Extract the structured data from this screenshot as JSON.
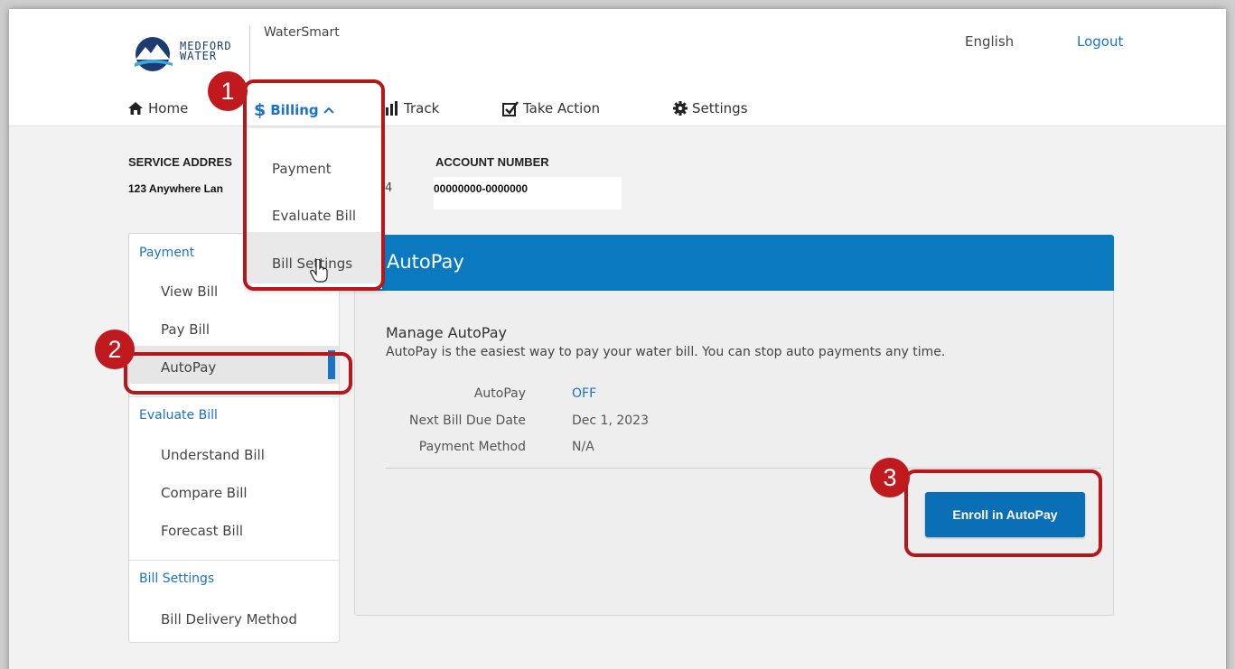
{
  "app": {
    "name": "WaterSmart",
    "logo_text": "MEDFORD WATER"
  },
  "header": {
    "language": "English",
    "logout": "Logout"
  },
  "nav": {
    "home": "Home",
    "billing": "Billing",
    "track": "Track",
    "take_action": "Take Action",
    "settings": "Settings"
  },
  "billing_menu": {
    "items": [
      "Payment",
      "Evaluate Bill",
      "Bill Settings"
    ]
  },
  "account": {
    "service_address_label": "SERVICE ADDRES",
    "service_address_value": "123 Anywhere Lan",
    "service_address_tail": "4",
    "account_number_label": "ACCOUNT NUMBER",
    "account_number_value": "00000000-0000000"
  },
  "sidebar": {
    "payment_header": "Payment",
    "payment_items": [
      "View Bill",
      "Pay Bill",
      "AutoPay"
    ],
    "evaluate_header": "Evaluate Bill",
    "evaluate_items": [
      "Understand Bill",
      "Compare Bill",
      "Forecast Bill"
    ],
    "settings_header": "Bill Settings",
    "settings_items": [
      "Bill Delivery Method"
    ],
    "active": "AutoPay"
  },
  "panel": {
    "title": "AutoPay",
    "heading": "Manage AutoPay",
    "description": "AutoPay is the easiest way to pay your water bill. You can stop auto payments any time.",
    "fields": [
      {
        "label": "AutoPay",
        "value": "OFF"
      },
      {
        "label": "Next Bill Due Date",
        "value": "Dec 1, 2023"
      },
      {
        "label": "Payment Method",
        "value": "N/A"
      }
    ],
    "enroll_button": "Enroll in AutoPay"
  },
  "callouts": [
    "1",
    "2",
    "3"
  ],
  "colors": {
    "accent": "#0b79c0",
    "link": "#1a73c7",
    "callout": "#b7161b",
    "autopay_off": "#1a73c7"
  },
  "icons": [
    "home-icon",
    "dollar-icon",
    "chevron-up-icon",
    "bar-chart-icon",
    "checkbox-icon",
    "gear-icon",
    "hand-cursor-icon",
    "medford-water-logo"
  ]
}
